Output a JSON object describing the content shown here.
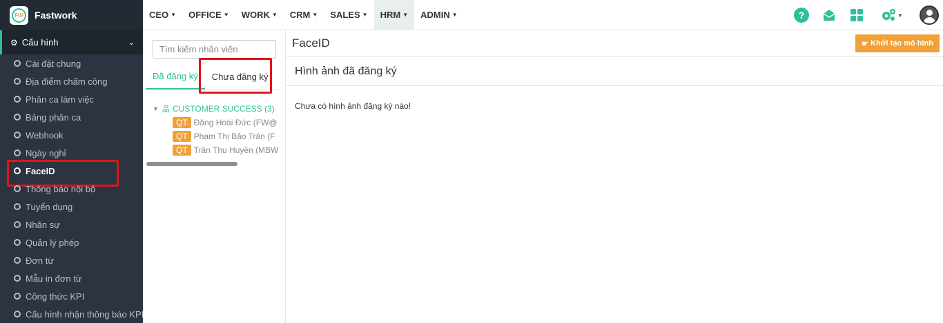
{
  "brand": {
    "name": "Fastwork",
    "logo_text": "FW"
  },
  "sidebar": {
    "section_label": "Cấu hình",
    "items": [
      {
        "label": "Cài đặt chung"
      },
      {
        "label": "Địa điểm chấm công"
      },
      {
        "label": "Phân ca làm việc"
      },
      {
        "label": "Bảng phân ca"
      },
      {
        "label": "Webhook"
      },
      {
        "label": "Ngày nghỉ"
      },
      {
        "label": "FaceID"
      },
      {
        "label": "Thông báo nội bộ"
      },
      {
        "label": "Tuyển dụng"
      },
      {
        "label": "Nhân sự"
      },
      {
        "label": "Quản lý phép"
      },
      {
        "label": "Đơn từ"
      },
      {
        "label": "Mẫu in đơn từ"
      },
      {
        "label": "Công thức KPI"
      },
      {
        "label": "Cấu hình nhận thông báo KPI"
      }
    ]
  },
  "topnav": {
    "items": [
      {
        "label": "CEO"
      },
      {
        "label": "OFFICE"
      },
      {
        "label": "WORK"
      },
      {
        "label": "CRM"
      },
      {
        "label": "SALES"
      },
      {
        "label": "HRM"
      },
      {
        "label": "ADMIN"
      }
    ],
    "help_glyph": "?"
  },
  "midpanel": {
    "search_placeholder": "Tìm kiếm nhân viên",
    "tabs": [
      {
        "label": "Đã đăng ký"
      },
      {
        "label": "Chưa đăng ký"
      }
    ],
    "tree": {
      "root_label": "CUSTOMER SUCCESS (3)",
      "badge": "QT",
      "members": [
        {
          "name": "Đặng Hoài Đức (FW@"
        },
        {
          "name": "Phạm Thị Bảo Trân (F"
        },
        {
          "name": "Trần Thu Huyền (MBW"
        }
      ]
    }
  },
  "content": {
    "title": "FaceID",
    "init_button_label": "Khởi tạo mô hình",
    "card_title": "Hình ảnh đã đăng ký",
    "empty_message": "Chưa có hình ảnh đăng ký nào!"
  },
  "colors": {
    "accent": "#2fbf9a",
    "sidebar_bg": "#2b3440",
    "button_orange": "#f0a13a",
    "highlight_red": "#e0151b"
  }
}
